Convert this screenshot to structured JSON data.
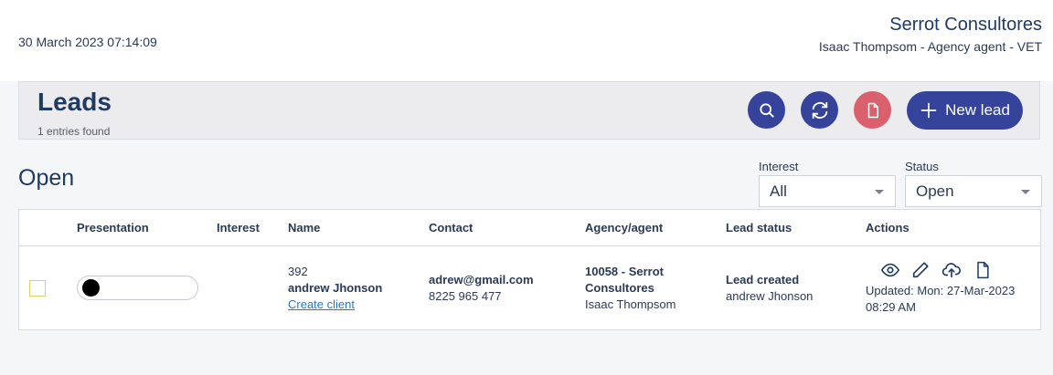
{
  "header": {
    "datetime": "30 March 2023 07:14:09",
    "company": "Serrot Consultores",
    "agent_line": "Isaac Thompsom - Agency agent - VET"
  },
  "leads": {
    "title": "Leads",
    "count_text": "1 entries found",
    "buttons": {
      "search_icon": "search-icon",
      "refresh_icon": "refresh-icon",
      "pdf_icon": "document-icon",
      "new_lead_label": "New lead"
    }
  },
  "section": {
    "title": "Open"
  },
  "filters": {
    "interest": {
      "label": "Interest",
      "value": "All"
    },
    "status": {
      "label": "Status",
      "value": "Open"
    }
  },
  "table": {
    "columns": [
      "Presentation",
      "Interest",
      "Name",
      "Contact",
      "Agency/agent",
      "Lead status",
      "Actions"
    ],
    "rows": [
      {
        "id": "392",
        "name": "andrew Jhonson",
        "create_client": "Create client",
        "interest": "",
        "email": "adrew@gmail.com",
        "phone": "8225 965 477",
        "agency_line1": "10058 - Serrot",
        "agency_line2": "Consultores",
        "agent": "Isaac Thompsom",
        "status": "Lead created",
        "status_by": "andrew Jhonson",
        "updated_line1": "Updated: Mon: 27-Mar-2023",
        "updated_line2": "08:29 AM"
      }
    ]
  },
  "colors": {
    "primary": "#35449a",
    "danger": "#d9606c",
    "link": "#1f78d1",
    "heading": "#1f3b63"
  }
}
